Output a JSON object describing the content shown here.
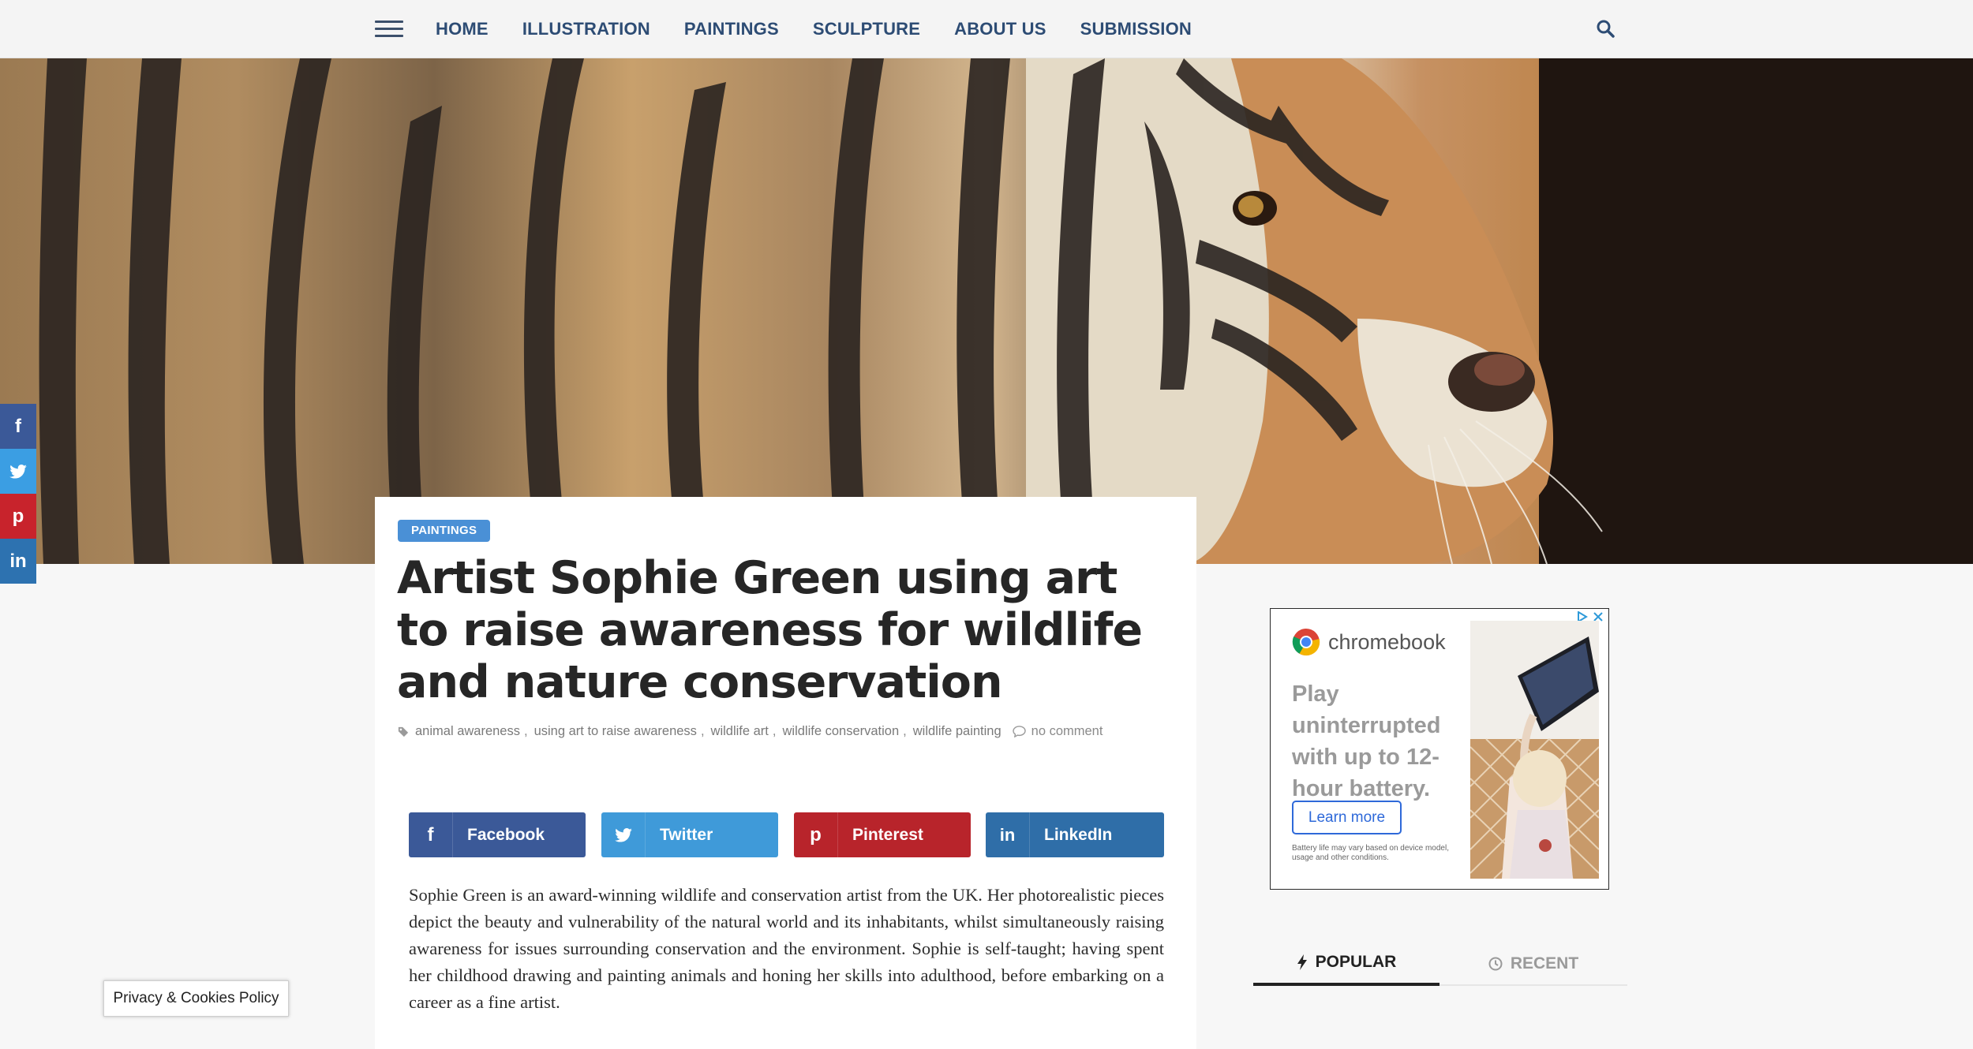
{
  "nav": {
    "items": [
      "HOME",
      "ILLUSTRATION",
      "PAINTINGS",
      "SCULPTURE",
      "ABOUT US",
      "SUBMISSION"
    ]
  },
  "article": {
    "category": "PAINTINGS",
    "title": "Artist Sophie Green using art to raise awareness for wildlife and nature conservation",
    "tags": [
      "animal awareness",
      "using art to raise awareness",
      "wildlife art",
      "wildlife conservation",
      "wildlife painting"
    ],
    "comments": "no comment",
    "share": {
      "facebook": "Facebook",
      "twitter": "Twitter",
      "pinterest": "Pinterest",
      "linkedin": "LinkedIn"
    },
    "body": "Sophie Green is an award-winning wildlife and conservation artist from the UK. Her photorealistic pieces depict the beauty and vulnerability of the natural world and its inhabitants, whilst simultaneously raising awareness for issues surrounding conservation and the environment. Sophie is self-taught; having spent her childhood drawing and painting animals and honing her skills into adulthood, before embarking on a career as a fine artist."
  },
  "ad": {
    "brand": "chromebook",
    "headline": "Play uninterrupted with up to 12-hour battery.",
    "button": "Learn more",
    "fineprint": "Battery life may vary based on device model, usage and other conditions."
  },
  "tabs": {
    "popular": "POPULAR",
    "recent": "RECENT"
  },
  "cookie": "Privacy & Cookies Policy",
  "colors": {
    "nav_text": "#2d4c74",
    "facebook": "#3b5998",
    "twitter": "#3f9ad9",
    "pinterest": "#b8242b",
    "linkedin": "#2f6ea8",
    "badge": "#4a90d6"
  },
  "icons": {
    "menu": "hamburger-icon",
    "search": "search-icon",
    "tag": "tag-icon",
    "comment": "comment-icon",
    "popular": "bolt-icon",
    "recent": "clock-icon"
  }
}
